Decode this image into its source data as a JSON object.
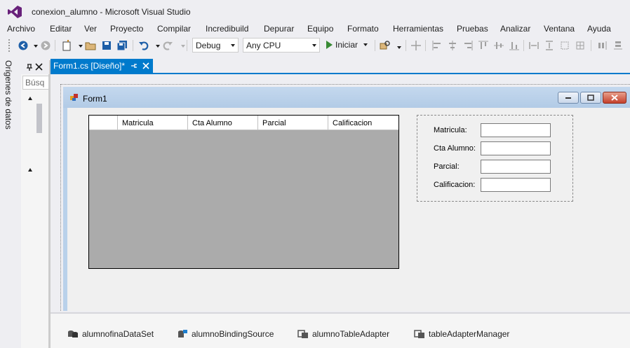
{
  "window": {
    "title": "conexion_alumno - Microsoft Visual Studio"
  },
  "menu": [
    "Archivo",
    "Editar",
    "Ver",
    "Proyecto",
    "Compilar",
    "Incredibuild",
    "Depurar",
    "Equipo",
    "Formato",
    "Herramientas",
    "Pruebas",
    "Analizar",
    "Ventana",
    "Ayuda"
  ],
  "toolbar": {
    "config": "Debug",
    "platform": "Any CPU",
    "start_label": "Iniciar"
  },
  "sidebar": {
    "vertical_tab": "Orígenes de datos",
    "search_placeholder": "Búsq"
  },
  "doc_tab": {
    "label": "Form1.cs [Diseño]*"
  },
  "form": {
    "title": "Form1",
    "grid_columns": [
      "Matricula",
      "Cta Alumno",
      "Parcial",
      "Calificacion"
    ],
    "fields": [
      "Matricula:",
      "Cta Alumno:",
      "Parcial:",
      "Calificacion:"
    ]
  },
  "tray": [
    "alumnofinaDataSet",
    "alumnoBindingSource",
    "alumnoTableAdapter",
    "tableAdapterManager"
  ],
  "colors": {
    "accent": "#007acc",
    "run_green": "#388a34",
    "vs_purple": "#68217a"
  }
}
